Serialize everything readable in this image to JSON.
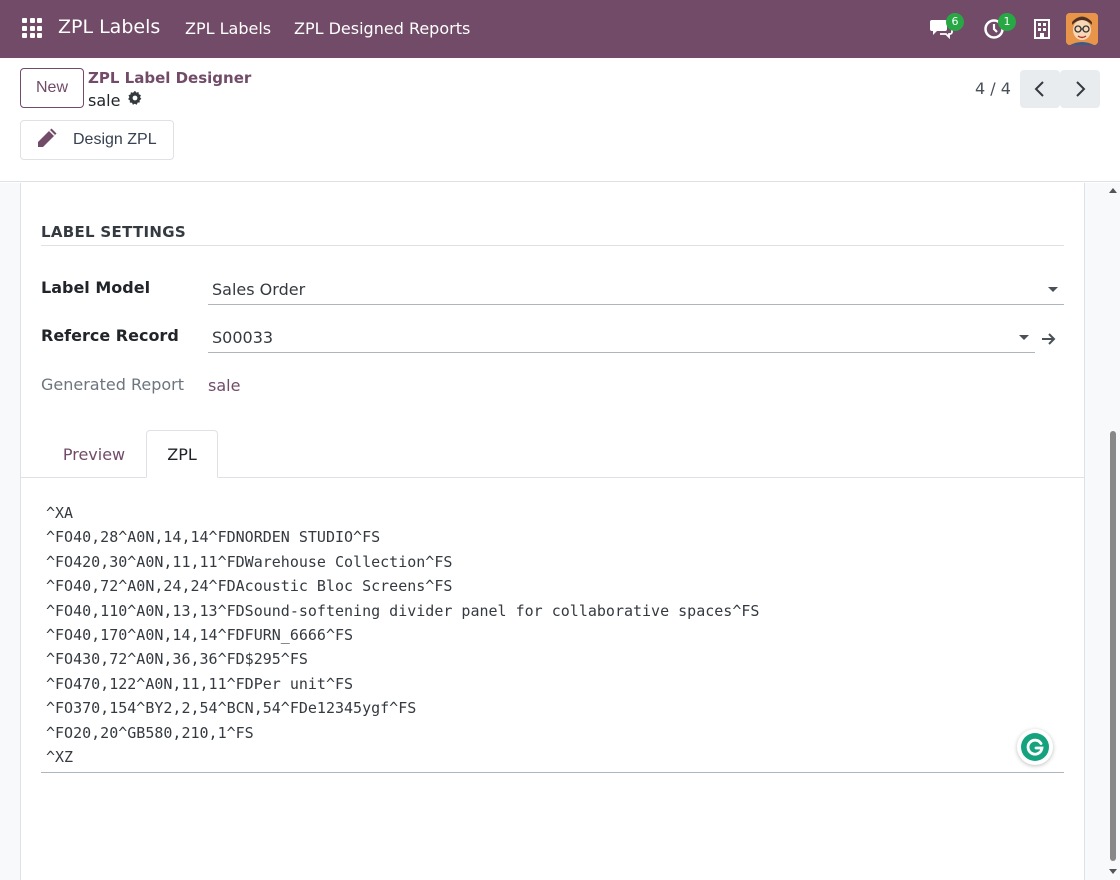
{
  "navbar": {
    "brand": "ZPL Labels",
    "menu": [
      "ZPL Labels",
      "ZPL Designed Reports"
    ],
    "messages_count": "6",
    "activities_count": "1",
    "bg_color": "#714B67"
  },
  "control_panel": {
    "new_label": "New",
    "breadcrumb_parent": "ZPL Label Designer",
    "breadcrumb_current": "sale",
    "design_button": "Design ZPL",
    "pager": "4 / 4"
  },
  "form": {
    "section_title": "LABEL SETTINGS",
    "label_model": {
      "label": "Label Model",
      "value": "Sales Order"
    },
    "reference_record": {
      "label": "Referce Record",
      "value": "S00033"
    },
    "generated_report": {
      "label": "Generated Report",
      "value": "sale"
    },
    "tabs": [
      "Preview",
      "ZPL"
    ],
    "active_tab": "ZPL",
    "zpl_lines": [
      "^XA",
      "^FO40,28^A0N,14,14^FDNORDEN STUDIO^FS",
      "^FO420,30^A0N,11,11^FDWarehouse Collection^FS",
      "^FO40,72^A0N,24,24^FDAcoustic Bloc Screens^FS",
      "^FO40,110^A0N,13,13^FDSound-softening divider panel for collaborative spaces^FS",
      "^FO40,170^A0N,14,14^FDFURN_6666^FS",
      "^FO430,72^A0N,36,36^FD$295^FS",
      "^FO470,122^A0N,11,11^FDPer unit^FS",
      "^FO370,154^BY2,2,54^BCN,54^FDe12345ygf^FS",
      "^FO20,20^GB580,210,1^FS",
      "^XZ"
    ]
  },
  "icons": [
    "apps-icon",
    "chat-icon",
    "clock-icon",
    "building-icon",
    "gear-icon",
    "pencil-icon",
    "chevron-left-icon",
    "chevron-right-icon",
    "arrow-right-icon",
    "grammarly-icon"
  ]
}
